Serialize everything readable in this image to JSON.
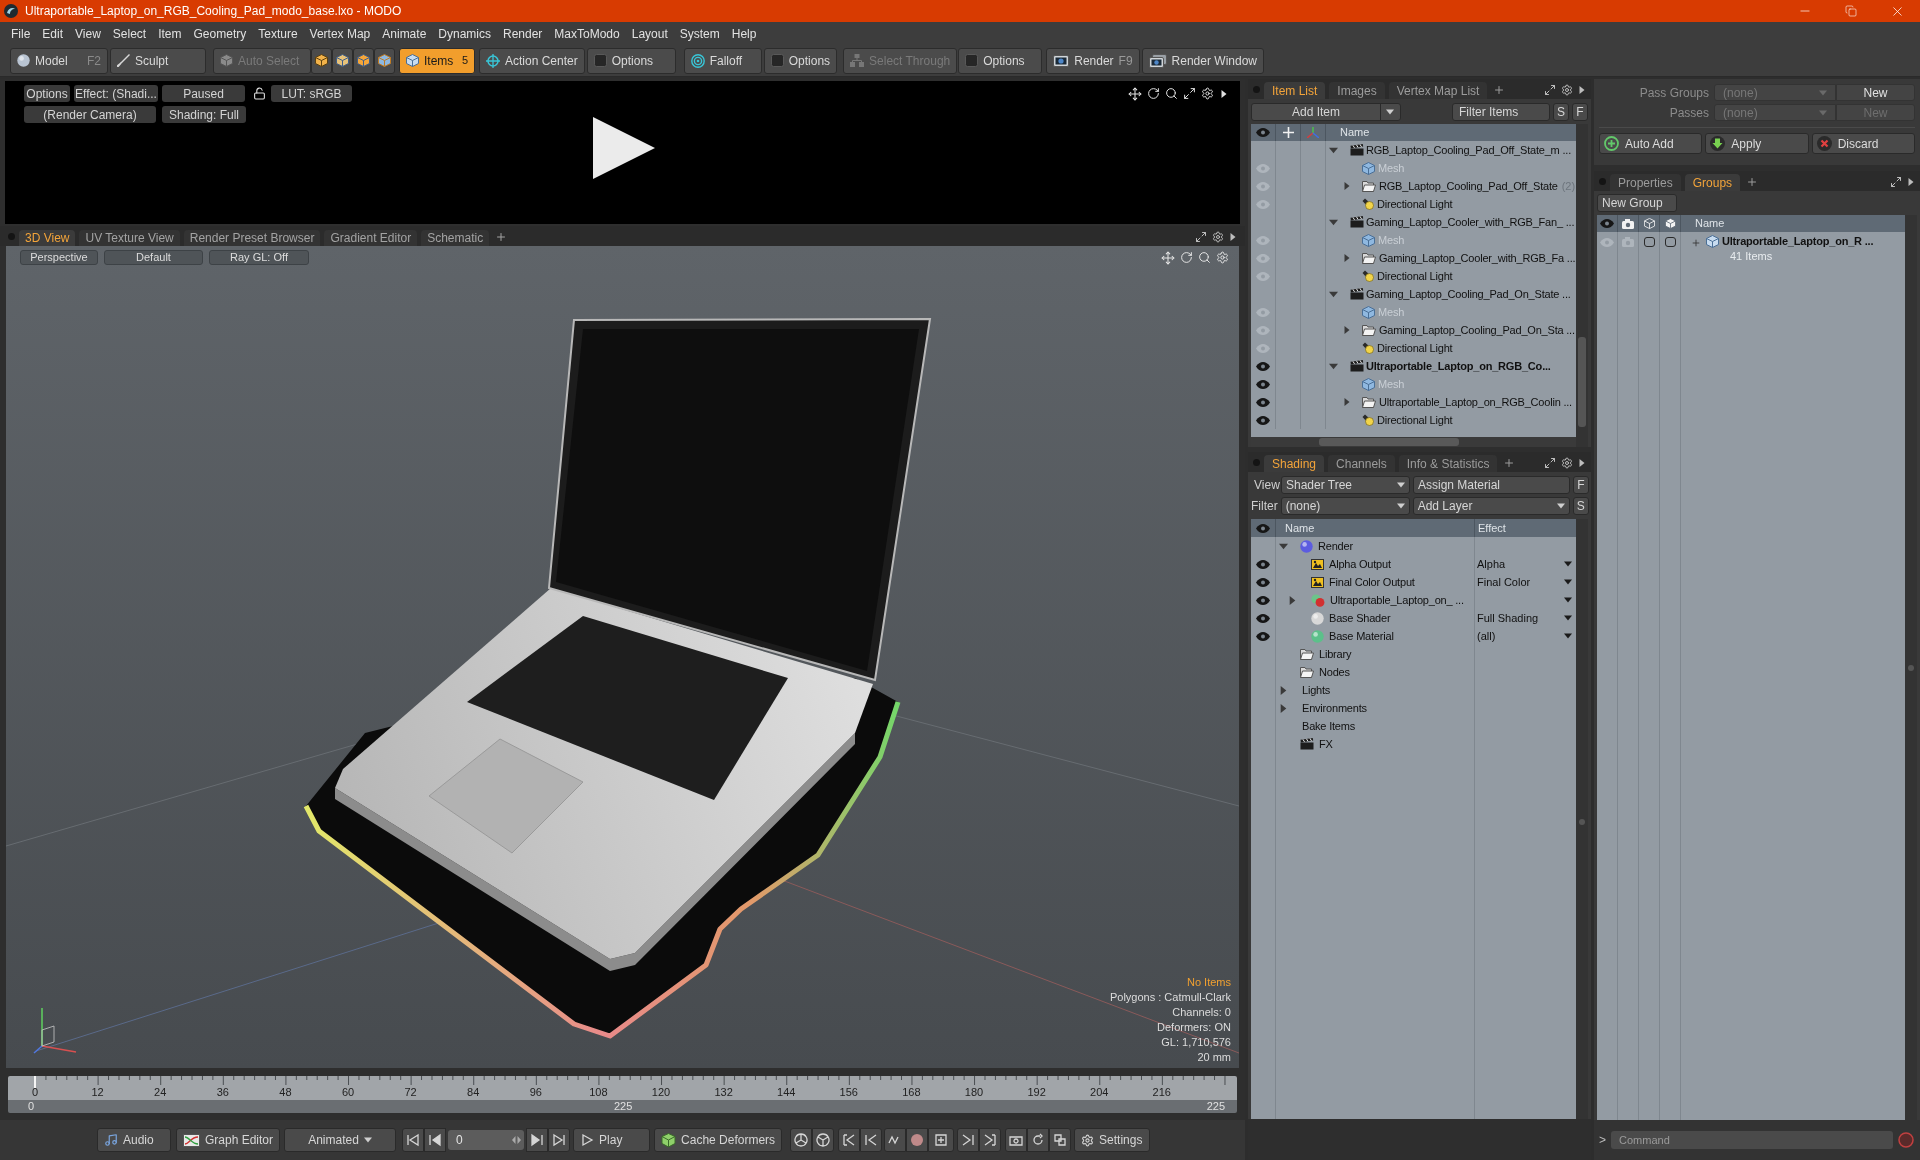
{
  "window": {
    "title": "Ultraportable_Laptop_on_RGB_Cooling_Pad_modo_base.lxo - MODO"
  },
  "menu": [
    "File",
    "Edit",
    "View",
    "Select",
    "Item",
    "Geometry",
    "Texture",
    "Vertex Map",
    "Animate",
    "Dynamics",
    "Render",
    "MaxToModo",
    "Layout",
    "System",
    "Help"
  ],
  "toolbar": {
    "modes": [
      {
        "label": "Model",
        "shortcut": "F2"
      },
      {
        "label": "Sculpt"
      }
    ],
    "auto_select": {
      "label": "Auto Select",
      "disabled": true
    },
    "selection_modes": [
      {
        "selected": false
      },
      {
        "selected": false
      },
      {
        "selected": false
      },
      {
        "selected": false
      },
      {
        "label": "Items",
        "count": "5",
        "selected": true
      }
    ],
    "tools": [
      {
        "label": "Action Center",
        "disabled": false
      },
      {
        "label": "Options",
        "disabled": false
      },
      {
        "label": "Falloff",
        "disabled": false
      },
      {
        "label": "Options",
        "disabled": false
      },
      {
        "label": "Select Through",
        "disabled": true
      },
      {
        "label": "Options",
        "disabled": false
      }
    ],
    "render": [
      {
        "label": "Render",
        "shortcut": "F9"
      },
      {
        "label": "Render Window"
      }
    ]
  },
  "render_preview": {
    "row_1": [
      "Options",
      "Effect: (Shadi...",
      "Paused"
    ],
    "lut": "LUT: sRGB",
    "row_2": [
      "(Render Camera)",
      "Shading: Full"
    ]
  },
  "viewport_tabs": [
    {
      "label": "3D View",
      "selected": true
    },
    {
      "label": "UV Texture View",
      "selected": false
    },
    {
      "label": "Render Preset Browser",
      "selected": false
    },
    {
      "label": "Gradient Editor",
      "selected": false
    },
    {
      "label": "Schematic",
      "selected": false
    }
  ],
  "viewport": {
    "toolbar": [
      "Perspective",
      "Default",
      "Ray GL: Off"
    ],
    "info": [
      {
        "text": "No Items",
        "highlight": true
      },
      {
        "text": "Polygons : Catmull-Clark",
        "highlight": false
      },
      {
        "text": "Channels: 0",
        "highlight": false
      },
      {
        "text": "Deformers: ON",
        "highlight": false
      },
      {
        "text": "GL: 1,710,576",
        "highlight": false
      },
      {
        "text": "20 mm",
        "highlight": false
      }
    ]
  },
  "timeline": {
    "ticks": [
      "0",
      "12",
      "24",
      "36",
      "48",
      "60",
      "72",
      "84",
      "96",
      "108",
      "120",
      "132",
      "144",
      "156",
      "168",
      "180",
      "192",
      "204",
      "216"
    ],
    "range": [
      "0",
      "225",
      "225"
    ]
  },
  "transport": {
    "audio": "Audio",
    "graph_editor": "Graph Editor",
    "mode": "Animated",
    "frame": "0",
    "play": "Play",
    "cache": "Cache Deformers",
    "settings": "Settings"
  },
  "item_list": {
    "tabs": [
      {
        "label": "Item List",
        "selected": true
      },
      {
        "label": "Images",
        "selected": false
      },
      {
        "label": "Vertex Map List",
        "selected": false
      }
    ],
    "add_item": "Add Item",
    "filter": "Filter Items",
    "filter_keys": [
      "S",
      "F"
    ],
    "column": "Name",
    "scenes": [
      {
        "name": "RGB_Laptop_Cooling_Pad_Off_State_m ...",
        "current": false,
        "expanded": true,
        "children": [
          {
            "kind": "mesh",
            "name": "Mesh"
          },
          {
            "kind": "group",
            "name": "RGB_Laptop_Cooling_Pad_Off_State",
            "count": "(2)",
            "expanded": false
          },
          {
            "kind": "light",
            "name": "Directional Light"
          }
        ]
      },
      {
        "name": "Gaming_Laptop_Cooler_with_RGB_Fan_ ...",
        "current": false,
        "expanded": true,
        "children": [
          {
            "kind": "mesh",
            "name": "Mesh"
          },
          {
            "kind": "group",
            "name": "Gaming_Laptop_Cooler_with_RGB_Fa ...",
            "expanded": false
          },
          {
            "kind": "light",
            "name": "Directional Light"
          }
        ]
      },
      {
        "name": "Gaming_Laptop_Cooling_Pad_On_State ...",
        "current": false,
        "expanded": true,
        "children": [
          {
            "kind": "mesh",
            "name": "Mesh"
          },
          {
            "kind": "group",
            "name": "Gaming_Laptop_Cooling_Pad_On_Sta ...",
            "expanded": false
          },
          {
            "kind": "light",
            "name": "Directional Light"
          }
        ]
      },
      {
        "name": "Ultraportable_Laptop_on_RGB_Co...",
        "current": true,
        "expanded": true,
        "children": [
          {
            "kind": "mesh",
            "name": "Mesh"
          },
          {
            "kind": "group",
            "name": "Ultraportable_Laptop_on_RGB_Coolin ...",
            "expanded": false
          },
          {
            "kind": "light",
            "name": "Directional Light"
          }
        ]
      }
    ]
  },
  "shading": {
    "tabs": [
      {
        "label": "Shading",
        "selected": true
      },
      {
        "label": "Channels",
        "selected": false
      },
      {
        "label": "Info & Statistics",
        "selected": false
      }
    ],
    "view_label": "View",
    "view": "Shader Tree",
    "assign": "Assign Material",
    "assign_key": "F",
    "filter_label": "Filter",
    "filter": "(none)",
    "add_layer": "Add Layer",
    "add_key": "S",
    "columns": [
      "Name",
      "Effect"
    ],
    "tree": [
      {
        "kind": "render",
        "name": "Render",
        "visible": false,
        "expanded": true,
        "children": [
          {
            "kind": "output",
            "name": "Alpha Output",
            "effect": "Alpha",
            "visible": true,
            "dropdown": true
          },
          {
            "kind": "output",
            "name": "Final Color Output",
            "effect": "Final Color",
            "visible": true,
            "dropdown": true
          },
          {
            "kind": "mask",
            "name": "Ultraportable_Laptop_on_ ...",
            "visible": true,
            "expanded": false,
            "dropdown": true
          },
          {
            "kind": "shader",
            "name": "Base Shader",
            "effect": "Full Shading",
            "visible": true,
            "dropdown": true
          },
          {
            "kind": "material",
            "name": "Base Material",
            "effect": "(all)",
            "visible": true,
            "dropdown": true
          }
        ]
      },
      {
        "kind": "folder",
        "name": "Library",
        "visible": false
      },
      {
        "kind": "folder",
        "name": "Nodes",
        "visible": false
      },
      {
        "kind": "category",
        "name": "Lights",
        "visible": false,
        "expanded": false
      },
      {
        "kind": "category",
        "name": "Environments",
        "visible": false,
        "expanded": false
      },
      {
        "kind": "category",
        "name": "Bake Items",
        "visible": false
      },
      {
        "kind": "fx",
        "name": "FX",
        "visible": false
      }
    ]
  },
  "passes": [
    {
      "label": "Pass Groups",
      "value": "(none)",
      "button": "New",
      "disabled": false
    },
    {
      "label": "Passes",
      "value": "(none)",
      "button": "New",
      "disabled": true
    }
  ],
  "group_actions": [
    "Auto Add",
    "Apply",
    "Discard"
  ],
  "groups": {
    "tabs": [
      {
        "label": "Properties",
        "selected": false
      },
      {
        "label": "Groups",
        "selected": true
      }
    ],
    "new_group": "New Group",
    "column": "Name",
    "rows": [
      {
        "name": "Ultraportable_Laptop_on_R ...",
        "count": "41 Items",
        "expanded": false,
        "toggles": [
          {
            "checked": false
          },
          {
            "checked": false
          }
        ]
      }
    ]
  },
  "command": {
    "prompt": ">",
    "placeholder": "Command"
  }
}
